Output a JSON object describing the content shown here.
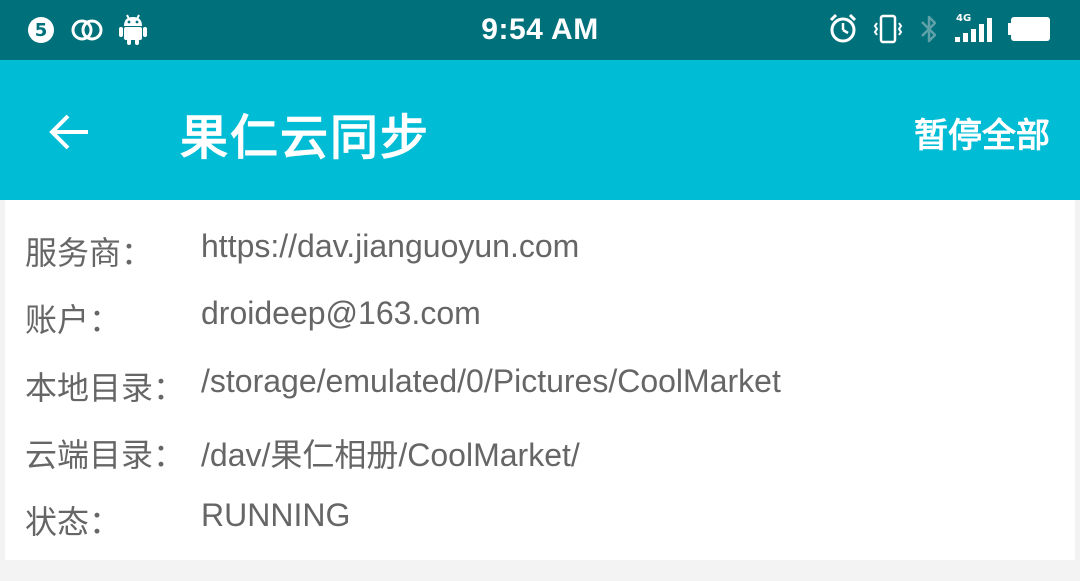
{
  "status_bar": {
    "time": "9:54 AM",
    "notif_badge": "5",
    "network_label": "4G",
    "icons": [
      "number-badge-icon",
      "linked-rings-icon",
      "android-icon",
      "alarm-icon",
      "vibrate-icon",
      "bluetooth-icon",
      "signal-icon",
      "battery-icon"
    ],
    "color": "#00707b"
  },
  "app_bar": {
    "title": "果仁云同步",
    "action": "暂停全部",
    "back_icon": "back-arrow-icon",
    "color": "#00bcd4"
  },
  "details": [
    {
      "label": "服务商：",
      "value": "https://dav.jianguoyun.com"
    },
    {
      "label": "账户：",
      "value": "droideep@163.com"
    },
    {
      "label": "本地目录：",
      "value": "/storage/emulated/0/Pictures/CoolMarket"
    },
    {
      "label": "云端目录：",
      "value": "/dav/果仁相册/CoolMarket/"
    },
    {
      "label": "状态：",
      "value": "RUNNING"
    }
  ]
}
